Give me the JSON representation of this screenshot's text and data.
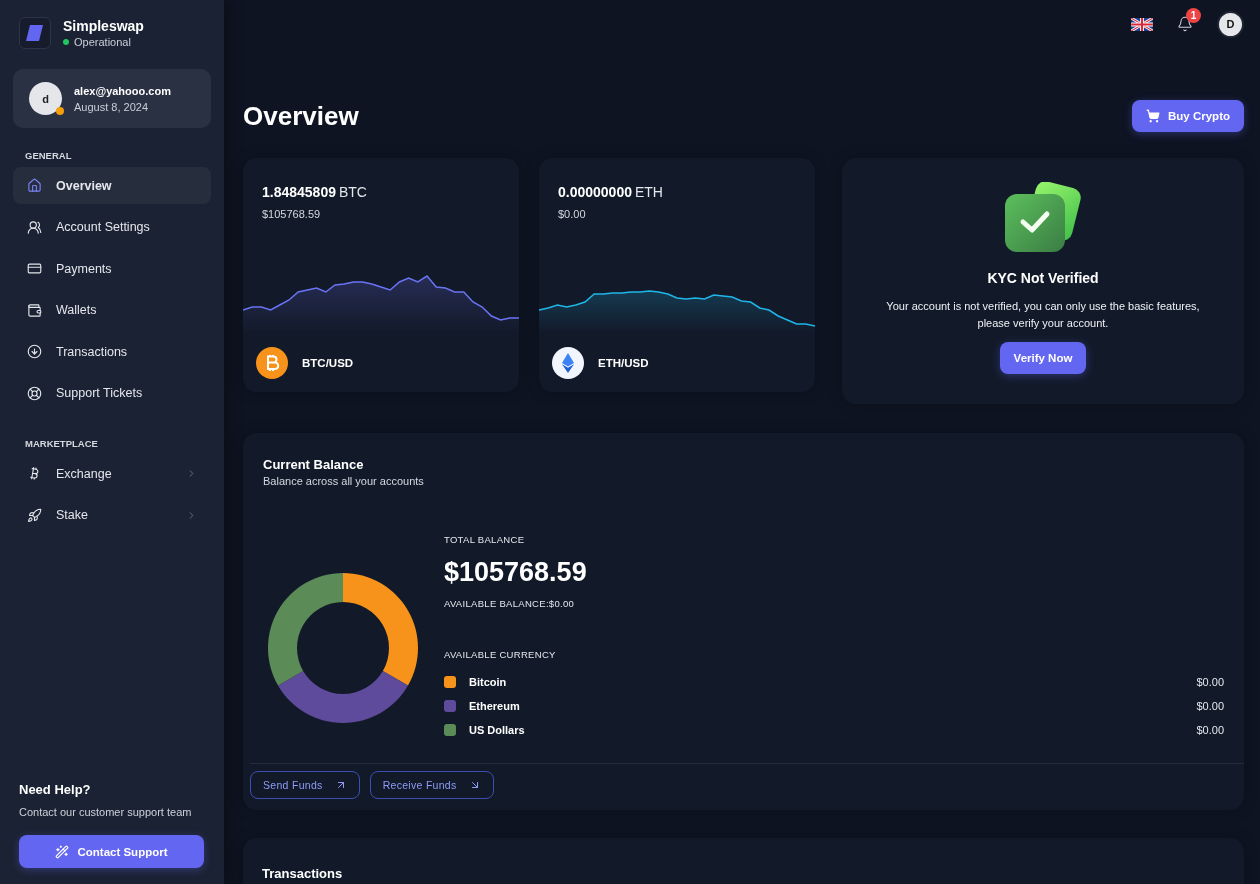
{
  "sidebar": {
    "brand": {
      "name": "Simpleswap",
      "status": "Operational"
    },
    "user": {
      "initial": "d",
      "email": "alex@yahooo.com",
      "date": "August 8, 2024"
    },
    "sections": [
      {
        "label": "GENERAL",
        "items": [
          {
            "label": "Overview",
            "selected": true,
            "has_submenu": false
          },
          {
            "label": "Account Settings",
            "selected": false,
            "has_submenu": false
          },
          {
            "label": "Payments",
            "selected": false,
            "has_submenu": false
          },
          {
            "label": "Wallets",
            "selected": false,
            "has_submenu": false
          },
          {
            "label": "Transactions",
            "selected": false,
            "has_submenu": false
          },
          {
            "label": "Support Tickets",
            "selected": false,
            "has_submenu": false
          }
        ]
      },
      {
        "label": "MARKETPLACE",
        "items": [
          {
            "label": "Exchange",
            "selected": false,
            "has_submenu": true
          },
          {
            "label": "Stake",
            "selected": false,
            "has_submenu": true
          }
        ]
      }
    ],
    "help": {
      "title": "Need Help?",
      "text": "Contact our customer support team",
      "button": "Contact Support"
    }
  },
  "topbar": {
    "notifications": "1",
    "avatar": "D"
  },
  "page": {
    "title": "Overview",
    "action": "Buy Crypto"
  },
  "assets": [
    {
      "kind": "btc",
      "amount": "1.84845809",
      "unit": "BTC",
      "fiat": "$105768.59",
      "pair": "BTC/USD"
    },
    {
      "kind": "eth",
      "amount": "0.00000000",
      "unit": "ETH",
      "fiat": "$0.00",
      "pair": "ETH/USD"
    }
  ],
  "kyc": {
    "title": "KYC Not Verified",
    "text": "Your account is not verified, you can only use the basic features, please verify your account.",
    "button": "Verify Now"
  },
  "balance": {
    "title": "Current Balance",
    "subtitle": "Balance across all your accounts",
    "total_label": "TOTAL BALANCE",
    "total": "$105768.59",
    "available": "AVAILABLE BALANCE:$0.00",
    "currency_label": "AVAILABLE CURRENCY",
    "currencies": [
      {
        "name": "Bitcoin",
        "value": "$0.00",
        "color": "#f7931a"
      },
      {
        "name": "Ethereum",
        "value": "$0.00",
        "color": "#5f4b9b"
      },
      {
        "name": "US Dollars",
        "value": "$0.00",
        "color": "#5b8c57"
      }
    ],
    "actions": [
      {
        "kind": "send",
        "label": "Send Funds"
      },
      {
        "kind": "receive",
        "label": "Receive Funds"
      }
    ]
  },
  "transactions": {
    "title": "Transactions"
  }
}
